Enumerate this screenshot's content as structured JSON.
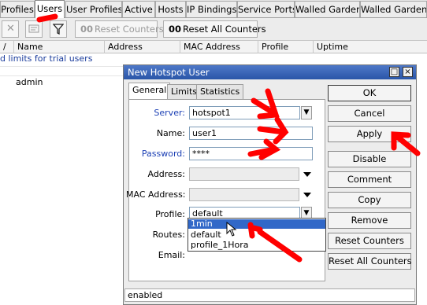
{
  "tabs": [
    {
      "label": "Profiles",
      "active": false
    },
    {
      "label": "Users",
      "active": true
    },
    {
      "label": "User Profiles",
      "active": false
    },
    {
      "label": "Active",
      "active": false
    },
    {
      "label": "Hosts",
      "active": false
    },
    {
      "label": "IP Bindings",
      "active": false
    },
    {
      "label": "Service Ports",
      "active": false
    },
    {
      "label": "Walled Garden",
      "active": false
    },
    {
      "label": "Walled Garden I",
      "active": false
    }
  ],
  "toolbar": {
    "remove_icon": "close-icon",
    "comment_icon": "comment-icon",
    "filter_icon": "filter-icon",
    "reset_counters_icon": "00",
    "reset_counters": "Reset Counters",
    "reset_all_icon": "00",
    "reset_all_counters": "Reset All Counters"
  },
  "columns": [
    "/",
    "Name",
    "Address",
    "MAC Address",
    "Profile",
    "Uptime"
  ],
  "list": {
    "comment": "d limits for trial users",
    "rows": [
      {
        "name": "admin"
      }
    ]
  },
  "dialog": {
    "title": "New Hotspot User",
    "tabs": [
      "General",
      "Limits",
      "Statistics"
    ],
    "fields": {
      "server": {
        "label": "Server:",
        "value": "hotspot1"
      },
      "name": {
        "label": "Name:",
        "value": "user1"
      },
      "password": {
        "label": "Password:",
        "value": "****"
      },
      "address": {
        "label": "Address:",
        "value": ""
      },
      "mac": {
        "label": "MAC Address:",
        "value": ""
      },
      "profile": {
        "label": "Profile:",
        "value": "default"
      },
      "routes": {
        "label": "Routes:"
      },
      "email": {
        "label": "Email:"
      }
    },
    "profile_options": [
      "1min",
      "default",
      "profile_1Hora"
    ],
    "buttons": [
      "OK",
      "Cancel",
      "Apply",
      "Disable",
      "Comment",
      "Copy",
      "Remove",
      "Reset Counters",
      "Reset All Counters"
    ],
    "status": "enabled",
    "minimize_glyph": "□",
    "close_glyph": "×"
  },
  "colors": {
    "accent": "#2a56a8",
    "selection": "#3168c8",
    "annotation": "#ff0000",
    "blue_label": "#1b3fb4"
  }
}
